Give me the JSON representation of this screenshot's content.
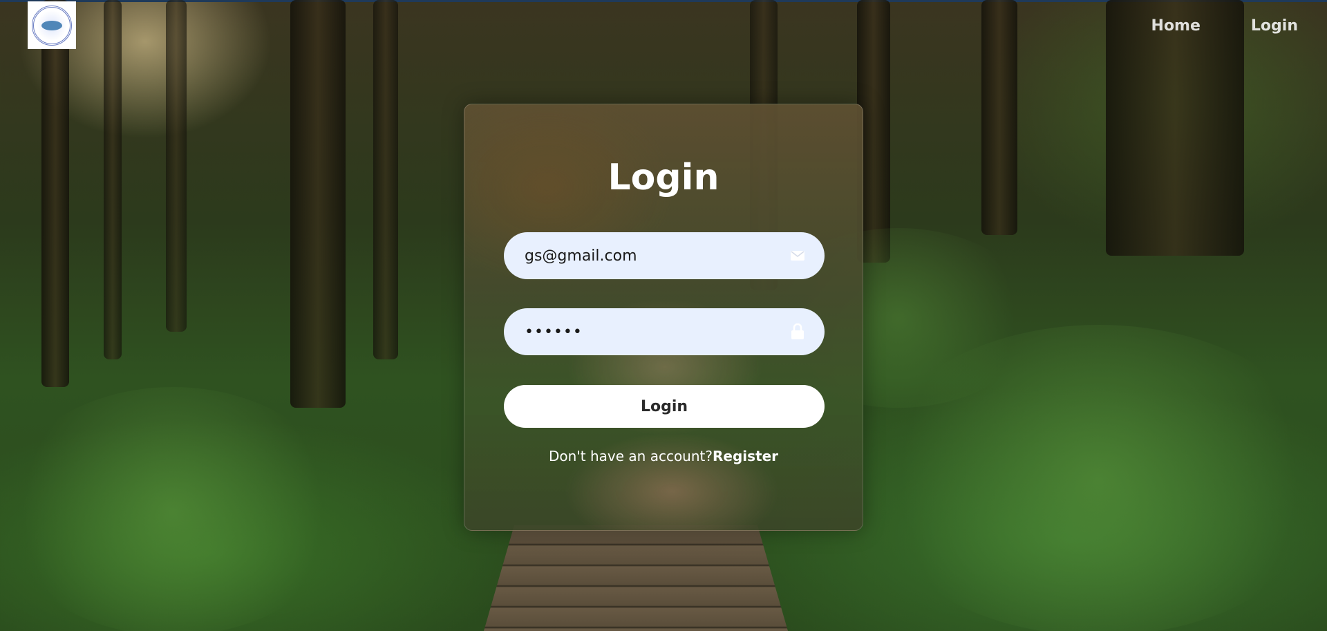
{
  "nav": {
    "items": [
      {
        "label": "Home"
      },
      {
        "label": "Login"
      }
    ]
  },
  "login": {
    "title": "Login",
    "email": {
      "value": "gs@gmail.com",
      "icon": "mail-icon"
    },
    "password": {
      "value": "••••••",
      "icon": "lock-icon"
    },
    "submit_label": "Login",
    "register_prompt": "Don't have an account?",
    "register_link": "Register"
  },
  "colors": {
    "field_bg": "#e8f0fe",
    "button_bg": "#ffffff",
    "text_light": "#ffffff"
  }
}
